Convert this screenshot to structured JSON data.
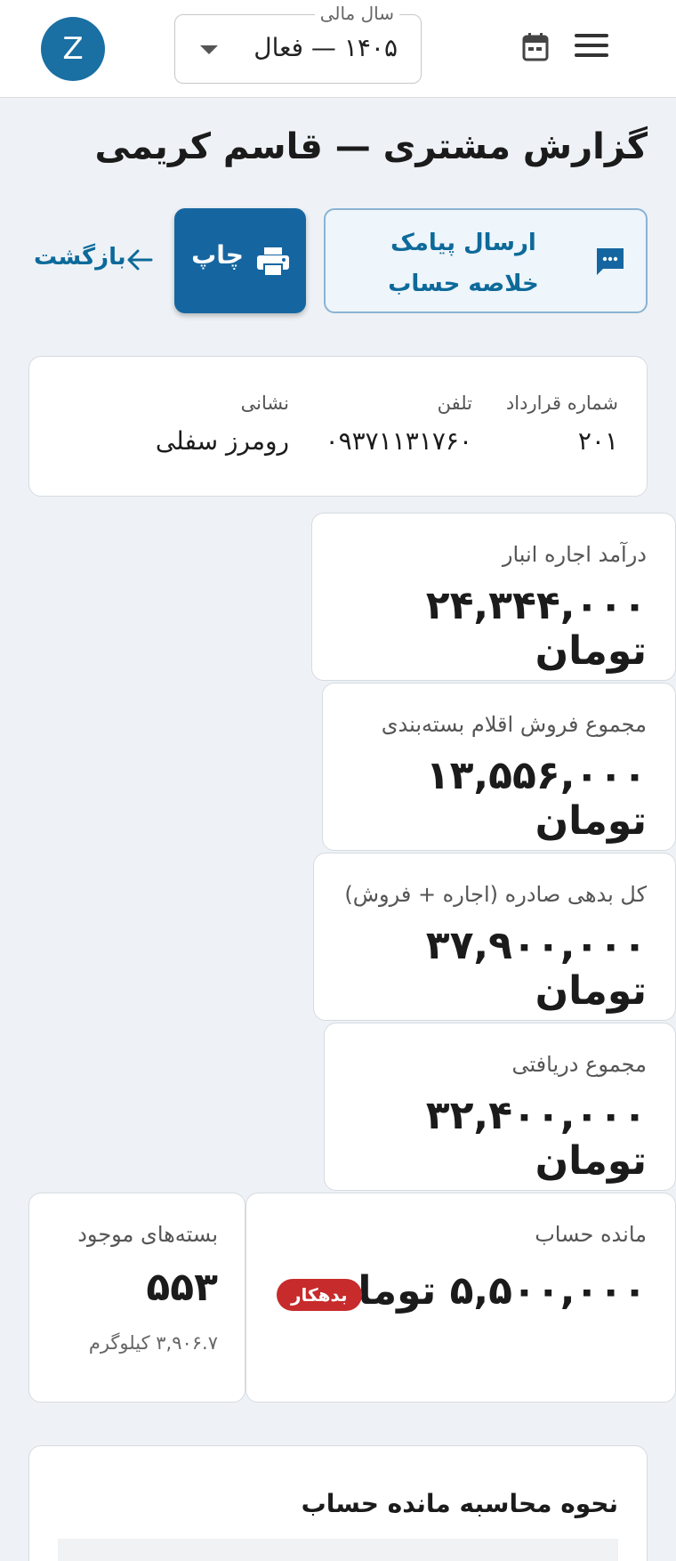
{
  "header": {
    "fiscal_year_label": "سال مالی",
    "fiscal_year_value": "۱۴۰۵ — فعال",
    "avatar_letter": "Z"
  },
  "page": {
    "title": "گزارش مشتری — قاسم کریمی"
  },
  "actions": {
    "sms_label": "ارسال پیامک خلاصه حساب",
    "print_label": "چاپ",
    "back_label": "بازگشت"
  },
  "info": {
    "contract_label": "شماره قرارداد",
    "contract_value": "۲۰۱",
    "phone_label": "تلفن",
    "phone_value": "۰۹۳۷۱۱۳۱۷۶۰",
    "address_label": "نشانی",
    "address_value": "رومرز سفلی"
  },
  "stats": {
    "rent_income_label": "درآمد اجاره انبار",
    "rent_income_value": "۲۴,۳۴۴,۰۰۰ تومان",
    "packaging_sales_label": "مجموع فروش اقلام بسته‌بندی",
    "packaging_sales_value": "۱۳,۵۵۶,۰۰۰ تومان",
    "total_debt_label": "کل بدهی صادره (اجاره + فروش)",
    "total_debt_value": "۳۷,۹۰۰,۰۰۰ تومان",
    "total_received_label": "مجموع دریافتی",
    "total_received_value": "۳۲,۴۰۰,۰۰۰ تومان",
    "balance_label": "مانده حساب",
    "balance_value": "۵,۵۰۰,۰۰۰ تومان",
    "balance_badge": "بدهکار",
    "packages_label": "بسته‌های موجود",
    "packages_value": "۵۵۳",
    "packages_weight": "۳,۹۰۶.۷ کیلوگرم"
  },
  "calc": {
    "title": "نحوه محاسبه مانده حساب"
  },
  "colors": {
    "accent": "#1566a0",
    "accent_text": "#0d6a9a",
    "badge_debtor": "#c72b2b",
    "background": "#eef2f6"
  }
}
